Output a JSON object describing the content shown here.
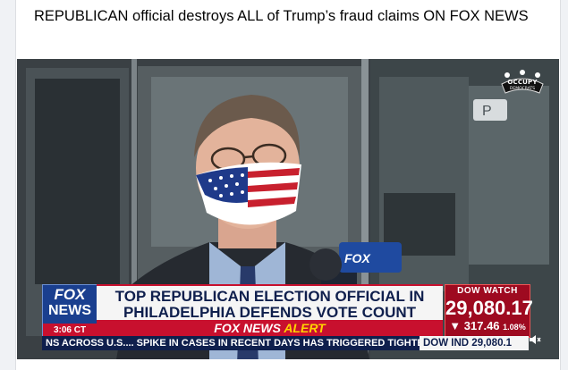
{
  "post": {
    "title": "REPUBLICAN official destroys ALL of Trump’s fraud claims ON FOX NEWS"
  },
  "video": {
    "watermark": {
      "name": "OCCUPY",
      "sub": "DEMOCRATS"
    },
    "lower_third": {
      "logo_line1": "FOX",
      "logo_line2": "NEWS",
      "time": "3:06 CT",
      "headline_line1": "TOP REPUBLICAN ELECTION OFFICIAL IN",
      "headline_line2": "PHILADELPHIA DEFENDS VOTE COUNT",
      "alert_brand": "FOX NEWS",
      "alert_word": "ALERT",
      "dow_label": "DOW WATCH",
      "dow_value": "29,080.17",
      "dow_change": "▼ 317.46",
      "dow_change_pct": "1.08%",
      "ticker_text": "NS ACROSS U.S....   SPIKE IN CASES IN RECENT DAYS HAS TRIGGERED TIGHTER R",
      "ticker_dow": "DOW IND 29,080.1"
    },
    "colors": {
      "fox_blue": "#1a3f8f",
      "fox_red": "#c8102e",
      "navy": "#0f1f4d"
    }
  }
}
